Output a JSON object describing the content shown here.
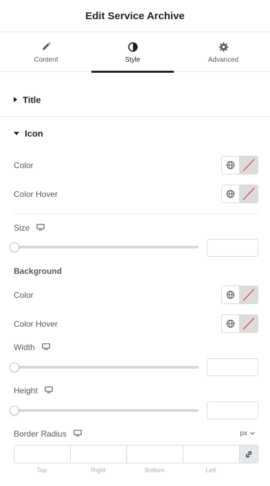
{
  "header": {
    "title": "Edit Service Archive"
  },
  "tabs": [
    {
      "label": "Content",
      "icon": "pencil-icon"
    },
    {
      "label": "Style",
      "icon": "half-circle-icon",
      "active": true
    },
    {
      "label": "Advanced",
      "icon": "gear-icon"
    }
  ],
  "sections": {
    "title": {
      "label": "Title",
      "expanded": false
    },
    "icon": {
      "label": "Icon",
      "expanded": true
    }
  },
  "icon_section": {
    "color_label": "Color",
    "color_hover_label": "Color Hover",
    "size_label": "Size",
    "size_value": "",
    "background_heading": "Background",
    "bg_color_label": "Color",
    "bg_color_hover_label": "Color Hover",
    "width_label": "Width",
    "width_value": "",
    "height_label": "Height",
    "height_value": "",
    "border_radius_label": "Border Radius",
    "unit": "px",
    "dimensions": [
      {
        "label": "Top",
        "value": ""
      },
      {
        "label": "Right",
        "value": ""
      },
      {
        "label": "Bottom",
        "value": ""
      },
      {
        "label": "Left",
        "value": ""
      }
    ]
  },
  "colors": {
    "text_dark": "#1f2124",
    "text_muted": "#515962",
    "border": "#d5d8dc",
    "swatch_empty": "#dcdcdc",
    "swatch_slash": "#e04b4b"
  }
}
